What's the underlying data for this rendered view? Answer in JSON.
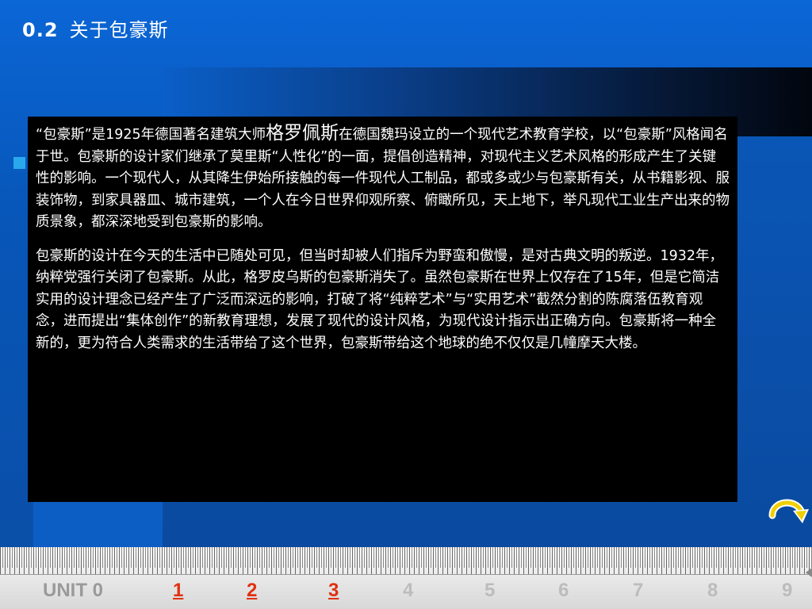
{
  "header": {
    "section_number": "0.2",
    "title": "关于包豪斯"
  },
  "content": {
    "paragraph1_a": "“包豪斯”是1925年德国著名建筑大师",
    "paragraph1_name": "格罗佩斯",
    "paragraph1_b": "在德国魏玛设立的一个现代艺术教育学校，以“包豪斯”风格闻名于世。包豪斯的设计家们继承了莫里斯“人性化”的一面，提倡创造精神，对现代主义艺术风格的形成产生了关键性的影响。一个现代人，从其降生伊始所接触的每一件现代人工制品，都或多或少与包豪斯有关，从书籍影视、服装饰物，到家具器皿、城市建筑，一个人在今日世界仰观所察、俯瞰所见，天上地下，举凡现代工业生产出来的物质景象，都深深地受到包豪斯的影响。",
    "paragraph2": "包豪斯的设计在今天的生活中已随处可见，但当时却被人们指斥为野蛮和傲慢，是对古典文明的叛逆。1932年，纳粹党强行关闭了包豪斯。从此，格罗皮乌斯的包豪斯消失了。虽然包豪斯在世界上仅存在了15年，但是它简洁实用的设计理念已经产生了广泛而深远的影响，打破了将“纯粹艺术”与“实用艺术”截然分割的陈腐落伍教育观念，进而提出“集体创作”的新教育理想，发展了现代的设计风格，为现代设计指示出正确方向。包豪斯将一种全新的，更为符合人类需求的生活带给了这个世界，包豪斯带给这个地球的绝不仅仅是几幢摩天大楼。"
  },
  "nav": {
    "unit_label": "UNIT 0",
    "items": [
      "1",
      "2",
      "3",
      "4",
      "5",
      "6",
      "7",
      "8",
      "9"
    ]
  },
  "icons": {
    "return": "return-arrow-icon"
  },
  "colors": {
    "background_blue": "#0a5fc8",
    "text_box": "#000000",
    "link_red": "#e03010",
    "inactive_gray": "#bcbcbc",
    "arrow_yellow": "#f0d000"
  }
}
